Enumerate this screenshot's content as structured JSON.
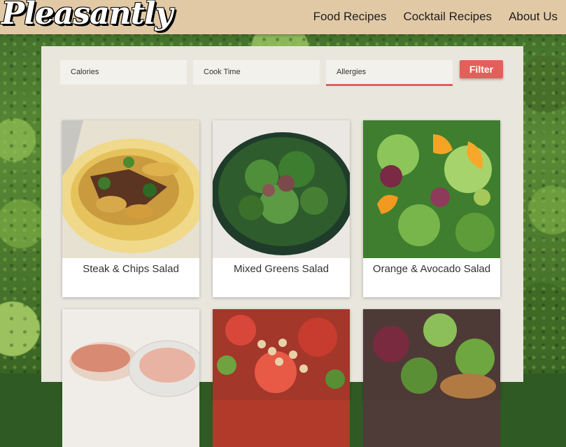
{
  "header": {
    "logo": "Pleasantly",
    "nav": [
      "Food Recipes",
      "Cocktail Recipes",
      "About Us"
    ]
  },
  "filters": {
    "calories_placeholder": "Calories",
    "cook_time_placeholder": "Cook Time",
    "allergies_placeholder": "Allergies",
    "button_label": "Filter"
  },
  "recipes": [
    {
      "title": "Steak & Chips Salad"
    },
    {
      "title": "Mixed Greens Salad"
    },
    {
      "title": "Orange & Avocado Salad"
    },
    {
      "title": ""
    },
    {
      "title": ""
    },
    {
      "title": ""
    }
  ],
  "colors": {
    "header_bg": "#e2c9a6",
    "panel_bg": "#e9e6de",
    "accent": "#e55f5a"
  }
}
